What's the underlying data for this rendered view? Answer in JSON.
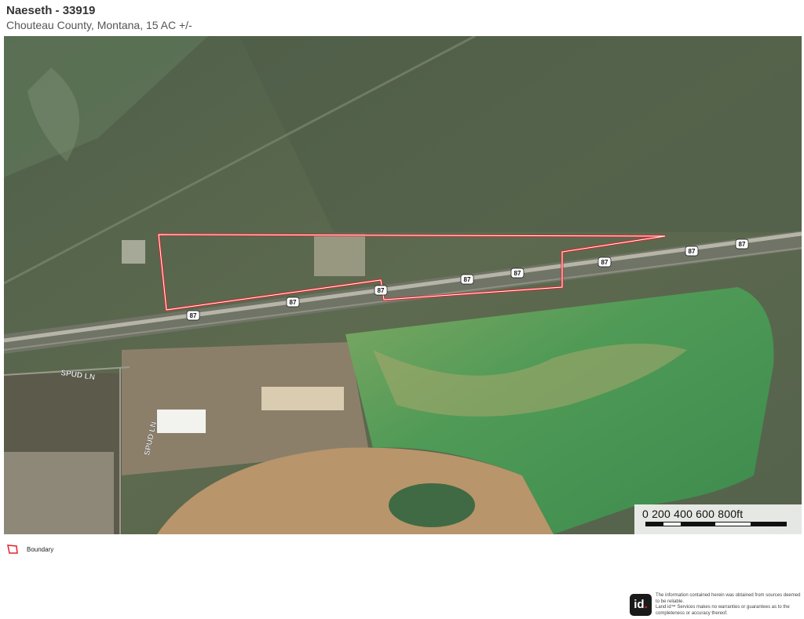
{
  "header": {
    "title": "Naeseth - 33919",
    "subtitle": "Chouteau County, Montana, 15 AC +/-"
  },
  "map": {
    "road_labels": [
      "SPUD LN",
      "SPUD LN"
    ],
    "highway_shields": [
      "87",
      "87",
      "87",
      "87",
      "87",
      "87",
      "87",
      "87"
    ],
    "boundary_color": "#e3232b"
  },
  "scale_bar": {
    "labels": "0   200  400   600  800ft"
  },
  "legend": {
    "label": "Boundary",
    "icon": "boundary-polygon-icon"
  },
  "footer": {
    "logo_text": "id",
    "disclaimer_line1": "The information contained herein was obtained from sources deemed to be reliable.",
    "disclaimer_line2": "Land id™ Services makes no warranties or guarantees as to the completeness or accuracy thereof."
  }
}
